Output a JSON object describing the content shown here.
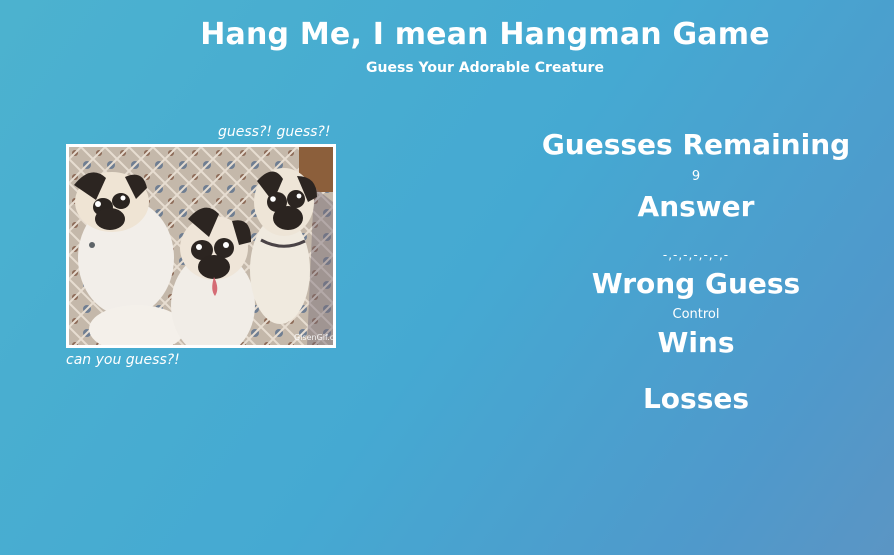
{
  "header": {
    "title": "Hang Me, I mean Hangman Game",
    "subtitle": "Guess Your Adorable Creature"
  },
  "image_panel": {
    "caption_top": "guess?! guess?!",
    "caption_bottom": "can you guess?!",
    "image_description_icon": "three-pugs-photo",
    "watermark": "GisenGif.com"
  },
  "stats": {
    "guesses_remaining_label": "Guesses Remaining",
    "guesses_remaining_value": "9",
    "answer_label": "Answer",
    "answer_value": "-,-,-,-,-,-,-",
    "wrong_guess_label": "Wrong Guess",
    "wrong_guess_value": "Control",
    "wins_label": "Wins",
    "losses_label": "Losses"
  },
  "colors": {
    "background_start": "#4cb2cf",
    "background_end": "#5b95c4",
    "text": "#ffffff",
    "frame": "#ffffff"
  }
}
